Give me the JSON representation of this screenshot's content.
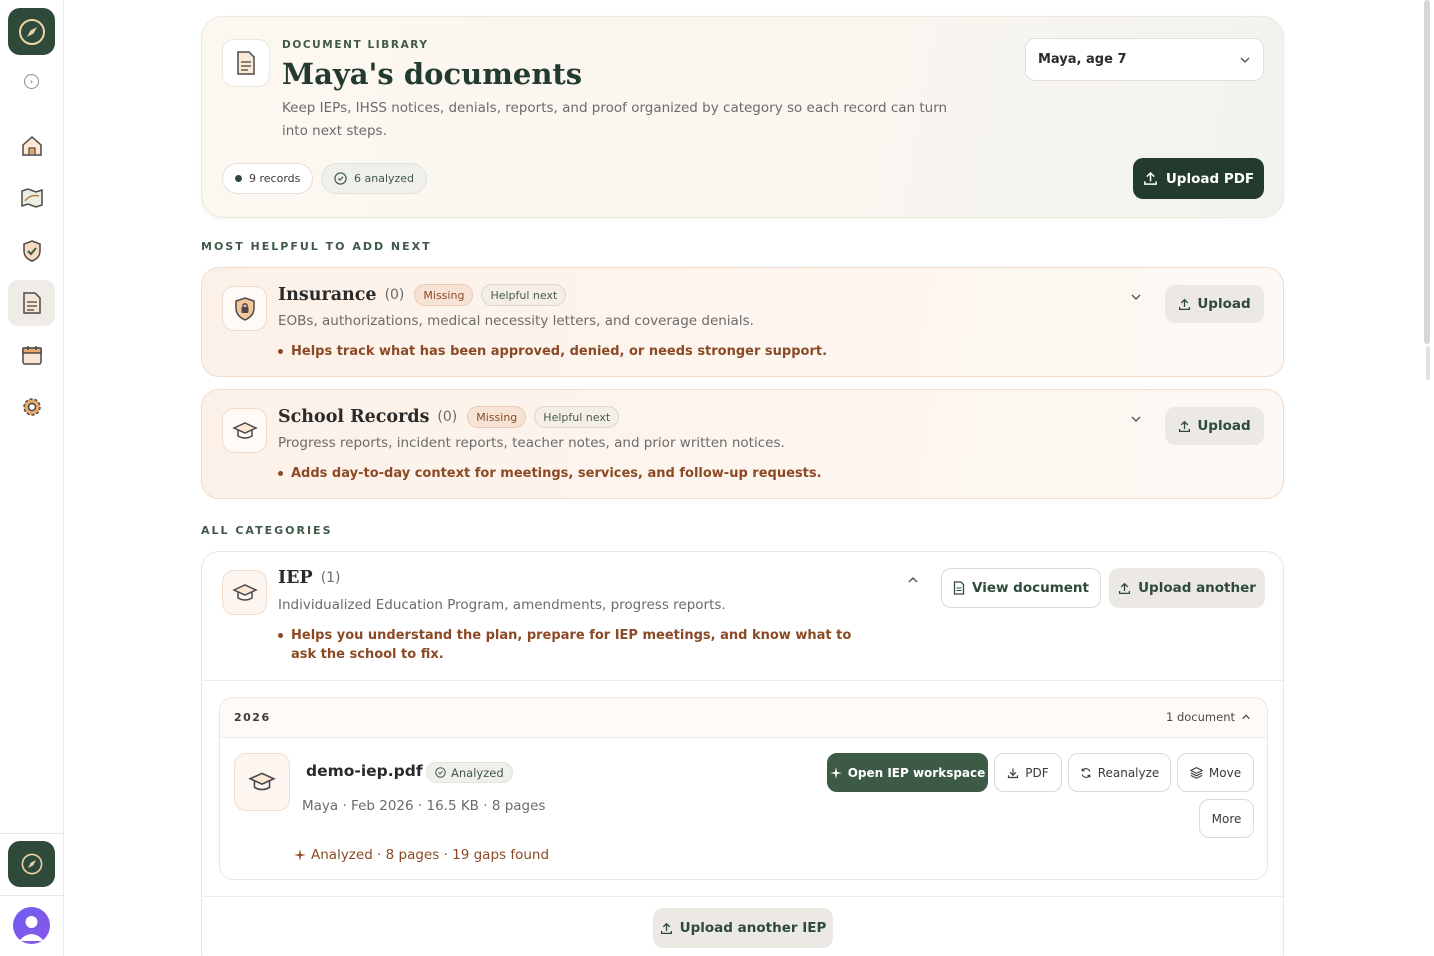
{
  "sidebar": {
    "logo": "compass-logo",
    "expand_icon": "expand-circle-icon",
    "nav": [
      {
        "name": "home",
        "icon": "home-icon"
      },
      {
        "name": "map",
        "icon": "map-icon"
      },
      {
        "name": "shield",
        "icon": "shield-check-icon"
      },
      {
        "name": "documents",
        "icon": "document-icon",
        "active": true
      },
      {
        "name": "calendar",
        "icon": "calendar-icon"
      },
      {
        "name": "settings",
        "icon": "gear-icon"
      }
    ],
    "assistant_icon": "compass-icon",
    "avatar_icon": "user-avatar-icon"
  },
  "header": {
    "eyebrow": "DOCUMENT LIBRARY",
    "title": "Maya's documents",
    "description": "Keep IEPs, IHSS notices, denials, reports, and proof organized by category so each record can turn into next steps.",
    "records_pill": "9 records",
    "analyzed_pill": "6 analyzed",
    "child_select": "Maya, age 7",
    "upload_pdf": "Upload PDF"
  },
  "suggestions": {
    "label": "MOST HELPFUL TO ADD NEXT",
    "items": [
      {
        "title": "Insurance",
        "count": "(0)",
        "tag_missing": "Missing",
        "tag_helpful": "Helpful next",
        "description": "EOBs, authorizations, medical necessity letters, and coverage denials.",
        "benefit": "Helps track what has been approved, denied, or needs stronger support.",
        "upload": "Upload"
      },
      {
        "title": "School Records",
        "count": "(0)",
        "tag_missing": "Missing",
        "tag_helpful": "Helpful next",
        "description": "Progress reports, incident reports, teacher notes, and prior written notices.",
        "benefit": "Adds day-to-day context for meetings, services, and follow-up requests.",
        "upload": "Upload"
      }
    ]
  },
  "categories": {
    "label": "ALL CATEGORIES",
    "iep": {
      "title": "IEP",
      "count": "(1)",
      "description": "Individualized Education Program, amendments, progress reports.",
      "benefit": "Helps you understand the plan, prepare for IEP meetings, and know what to ask the school to fix.",
      "view_document": "View document",
      "upload_another": "Upload another",
      "year": "2026",
      "doc_count": "1 document",
      "file": {
        "name": "demo-iep.pdf",
        "badge": "Analyzed",
        "meta": "Maya · Feb 2026 · 16.5 KB · 8 pages",
        "analysis": "Analyzed · 8 pages · 19 gaps found"
      },
      "actions": {
        "open_workspace": "Open IEP workspace",
        "pdf": "PDF",
        "reanalyze": "Reanalyze",
        "move": "Move",
        "more": "More"
      },
      "upload_another_iep": "Upload another IEP"
    }
  },
  "colors": {
    "brand_dark": "#233b2d",
    "accent_brown": "#8b4a25",
    "primary_green": "#3d5a46"
  }
}
